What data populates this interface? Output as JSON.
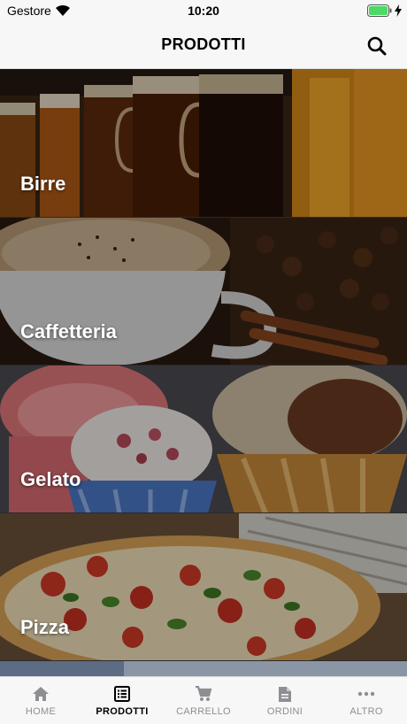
{
  "status_bar": {
    "carrier": "Gestore",
    "time": "10:20"
  },
  "header": {
    "title": "PRODOTTI"
  },
  "categories": [
    {
      "label": "Birre"
    },
    {
      "label": "Caffetteria"
    },
    {
      "label": "Gelato"
    },
    {
      "label": "Pizza"
    }
  ],
  "tabs": [
    {
      "label": "HOME",
      "icon": "home-icon",
      "active": false
    },
    {
      "label": "PRODOTTI",
      "icon": "list-icon",
      "active": true
    },
    {
      "label": "CARRELLO",
      "icon": "cart-icon",
      "active": false
    },
    {
      "label": "ORDINI",
      "icon": "document-icon",
      "active": false
    },
    {
      "label": "ALTRO",
      "icon": "more-icon",
      "active": false
    }
  ],
  "colors": {
    "bar_bg": "#f7f7f7",
    "battery": "#4cd964",
    "tab_inactive": "#8e8e93",
    "tab_active": "#000000"
  }
}
